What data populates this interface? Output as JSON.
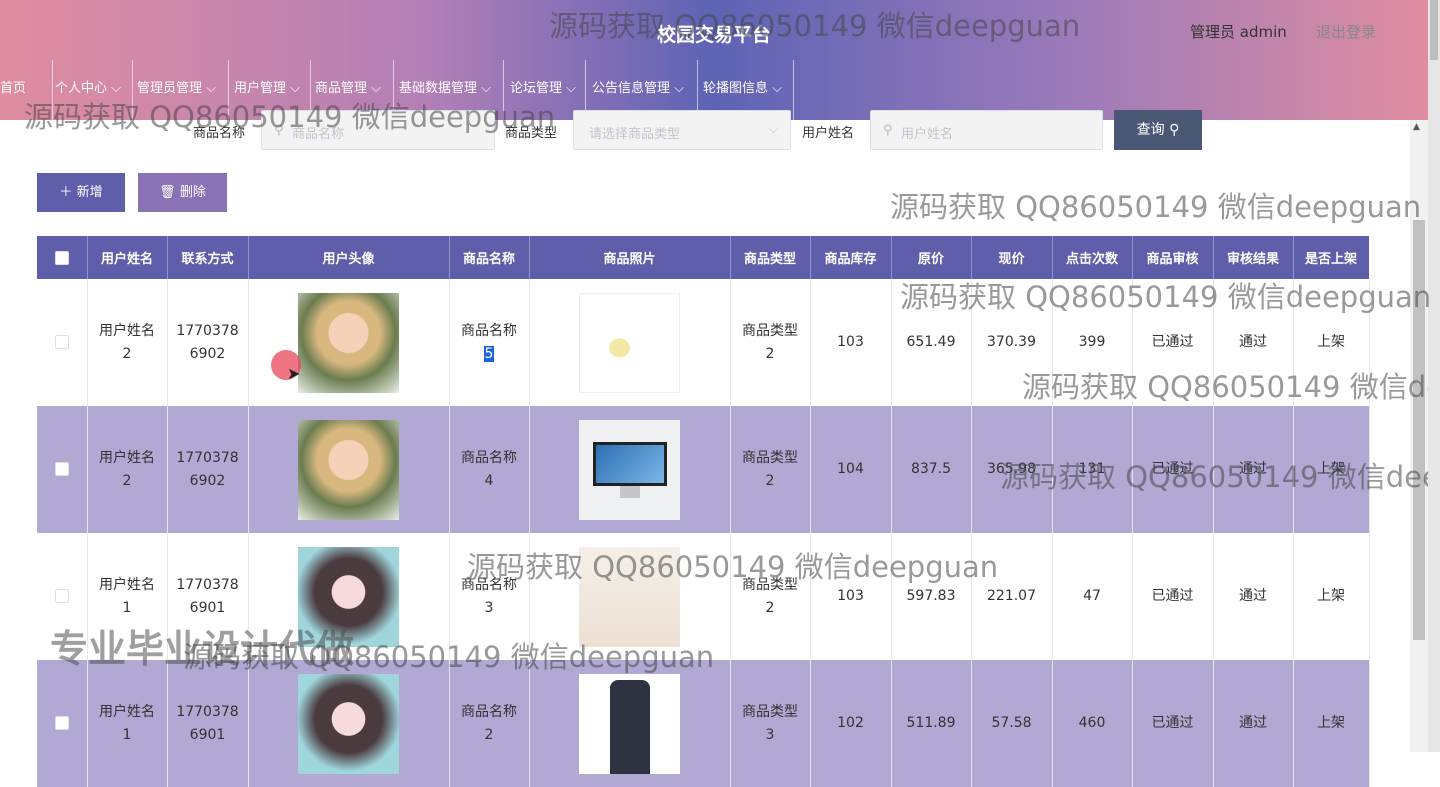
{
  "header": {
    "title": "校园交易平台",
    "user": "管理员 admin",
    "logout": "退出登录"
  },
  "nav": [
    "首页",
    "个人中心",
    "管理员管理",
    "用户管理",
    "商品管理",
    "基础数据管理",
    "论坛管理",
    "公告信息管理",
    "轮播图信息"
  ],
  "search": {
    "label_goods_name": "商品名称",
    "placeholder_goods_name": "商品名称",
    "label_goods_type": "商品类型",
    "placeholder_goods_type": "请选择商品类型",
    "label_user_name": "用户姓名",
    "placeholder_user_name": "用户姓名",
    "query_button": "查询"
  },
  "actions": {
    "add": "新增",
    "delete": "删除"
  },
  "table": {
    "headers": [
      "用户姓名",
      "联系方式",
      "用户头像",
      "商品名称",
      "商品照片",
      "商品类型",
      "商品库存",
      "原价",
      "现价",
      "点击次数",
      "商品审核",
      "审核结果",
      "是否上架"
    ],
    "rows": [
      {
        "user_name": [
          "用户姓名",
          "2"
        ],
        "phone": [
          "1770378",
          "6902"
        ],
        "goods_name": [
          "商品名称",
          "5"
        ],
        "goods_type": [
          "商品类型",
          "2"
        ],
        "stock": "103",
        "orig_price": "651.49",
        "cur_price": "370.39",
        "clicks": "399",
        "review": "已通过",
        "result": "通过",
        "shelf": "上架"
      },
      {
        "user_name": [
          "用户姓名",
          "2"
        ],
        "phone": [
          "1770378",
          "6902"
        ],
        "goods_name": [
          "商品名称",
          "4"
        ],
        "goods_type": [
          "商品类型",
          "2"
        ],
        "stock": "104",
        "orig_price": "837.5",
        "cur_price": "365.98",
        "clicks": "131",
        "review": "已通过",
        "result": "通过",
        "shelf": "上架"
      },
      {
        "user_name": [
          "用户姓名",
          "1"
        ],
        "phone": [
          "1770378",
          "6901"
        ],
        "goods_name": [
          "商品名称",
          "3"
        ],
        "goods_type": [
          "商品类型",
          "2"
        ],
        "stock": "103",
        "orig_price": "597.83",
        "cur_price": "221.07",
        "clicks": "47",
        "review": "已通过",
        "result": "通过",
        "shelf": "上架"
      },
      {
        "user_name": [
          "用户姓名",
          "1"
        ],
        "phone": [
          "1770378",
          "6901"
        ],
        "goods_name": [
          "商品名称",
          "2"
        ],
        "goods_type": [
          "商品类型",
          "3"
        ],
        "stock": "102",
        "orig_price": "511.89",
        "cur_price": "57.58",
        "clicks": "460",
        "review": "已通过",
        "result": "通过",
        "shelf": "上架"
      }
    ]
  },
  "watermarks": {
    "text": "源码获取 QQ86050149 微信deepguan",
    "big_text": "专业毕业设计代做"
  }
}
